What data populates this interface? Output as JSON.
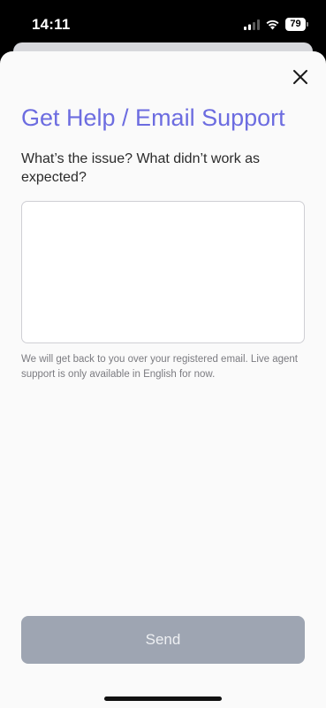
{
  "status_bar": {
    "time": "14:11",
    "battery_level": "79"
  },
  "sheet": {
    "title": "Get Help / Email Support",
    "question": "What’s the issue?  What didn’t work as expected?",
    "textarea": {
      "value": "",
      "placeholder": ""
    },
    "helper_text": "We will get back to you over your registered email. Live agent support is only available in English for now.",
    "send_label": "Send"
  },
  "colors": {
    "title": "#6c6ce0",
    "send_button_disabled": "#9ea5b2",
    "sheet_background": "#fafafa"
  },
  "icons": {
    "close": "close-icon",
    "signal": "cellular-signal-icon",
    "wifi": "wifi-icon",
    "battery": "battery-icon"
  }
}
